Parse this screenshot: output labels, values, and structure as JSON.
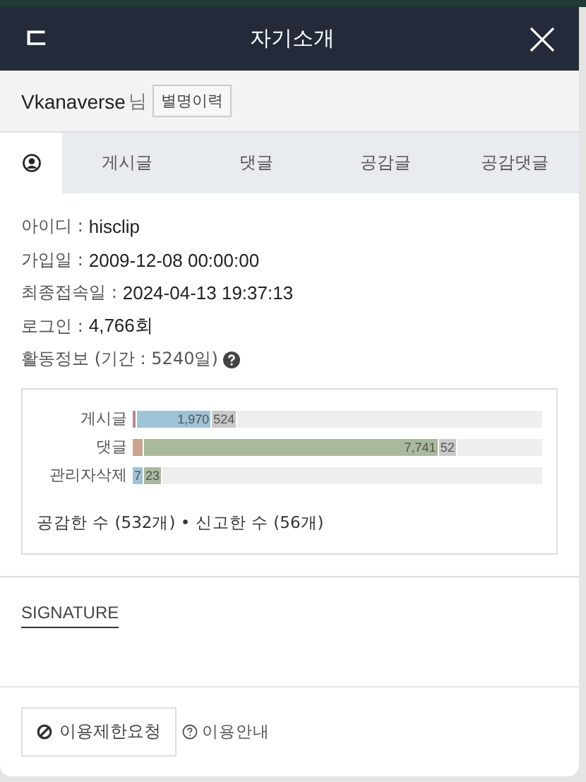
{
  "header": {
    "back_glyph": "ㄷ",
    "title": "자기소개"
  },
  "user": {
    "name": "Vkanaverse",
    "suffix": "님",
    "history_button": "별명이력"
  },
  "tabs": [
    {
      "kind": "icon",
      "selected": true
    },
    {
      "kind": "text",
      "label": "게시글",
      "selected": false
    },
    {
      "kind": "text",
      "label": "댓글",
      "selected": false
    },
    {
      "kind": "text",
      "label": "공감글",
      "selected": false
    },
    {
      "kind": "text",
      "label": "공감댓글",
      "selected": false
    }
  ],
  "info": [
    {
      "label": "아이디 :",
      "value": "hisclip"
    },
    {
      "label": "가입일 :",
      "value": "2009-12-08 00:00:00"
    },
    {
      "label": "최종접속일 :",
      "value": "2024-04-13 19:37:13"
    },
    {
      "label": "로그인 :",
      "value": "4,766회"
    }
  ],
  "activity": {
    "title": "활동정보 (기간 : 5240일)",
    "help": true
  },
  "bars": [
    {
      "label": "게시글",
      "segments": [
        {
          "kind": "marker",
          "color": "#b58a90"
        },
        {
          "kind": "count",
          "color": "#9fc3d6",
          "text": "1,970"
        },
        {
          "kind": "count",
          "color": "#c8c8c8",
          "text": "524"
        }
      ]
    },
    {
      "label": "댓글",
      "segments": [
        {
          "kind": "marker",
          "color": "#c9a38e"
        },
        {
          "kind": "count",
          "color": "#a9b99c",
          "text": "7,741"
        },
        {
          "kind": "count",
          "color": "#c8c8c8",
          "text": "52"
        }
      ]
    },
    {
      "label": "관리자삭제",
      "segments": [
        {
          "kind": "count",
          "color": "#9fc3d6",
          "text": "7"
        },
        {
          "kind": "count",
          "color": "#a9b99c",
          "text": "23"
        }
      ]
    }
  ],
  "summary": "공감한 수 (532개) • 신고한 수 (56개)",
  "signature": {
    "heading": "SIGNATURE"
  },
  "footer": {
    "restrict_button": "이용제한요청",
    "guide_link": "이용안내"
  }
}
